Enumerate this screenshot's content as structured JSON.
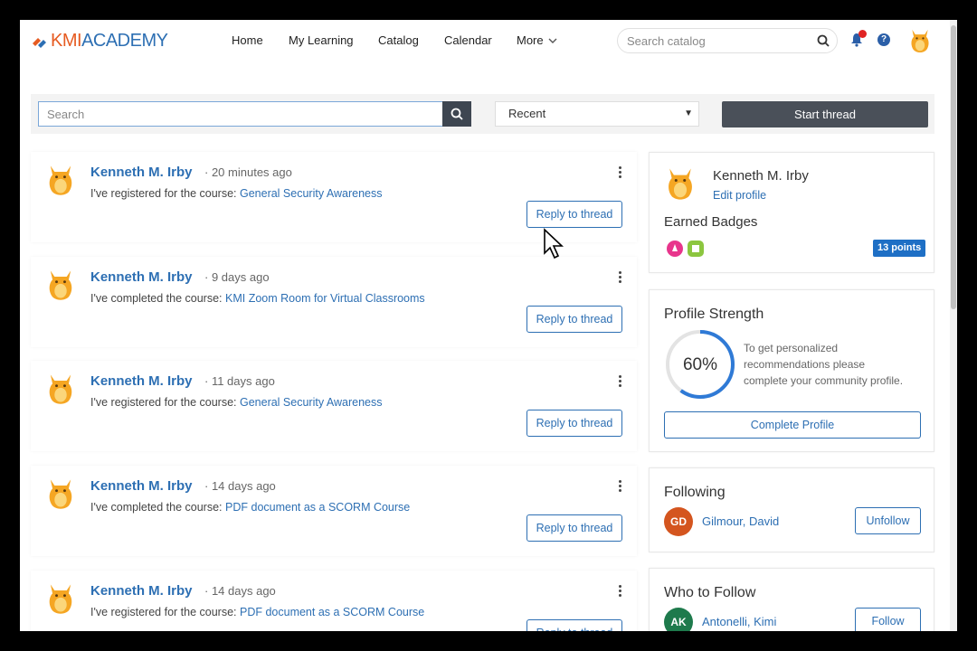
{
  "header": {
    "logo_prefix": "KMI",
    "logo_suffix": "ACADEMY",
    "nav": [
      "Home",
      "My Learning",
      "Catalog",
      "Calendar",
      "More"
    ],
    "search_placeholder": "Search catalog",
    "help_glyph": "?"
  },
  "toolbar": {
    "search_placeholder": "Search",
    "sort_value": "Recent",
    "start_thread_label": "Start thread"
  },
  "feed": [
    {
      "name": "Kenneth M. Irby",
      "time": "20 minutes ago",
      "action": "I've registered for the course:",
      "course": "General Security Awareness",
      "reply": "Reply to thread"
    },
    {
      "name": "Kenneth M. Irby",
      "time": "9 days ago",
      "action": "I've completed the course:",
      "course": "KMI Zoom Room for Virtual Classrooms",
      "reply": "Reply to thread"
    },
    {
      "name": "Kenneth M. Irby",
      "time": "11 days ago",
      "action": "I've registered for the course:",
      "course": "General Security Awareness",
      "reply": "Reply to thread"
    },
    {
      "name": "Kenneth M. Irby",
      "time": "14 days ago",
      "action": "I've completed the course:",
      "course": "PDF document as a SCORM Course",
      "reply": "Reply to thread"
    },
    {
      "name": "Kenneth M. Irby",
      "time": "14 days ago",
      "action": "I've registered for the course:",
      "course": "PDF document as a SCORM Course",
      "reply": "Reply to thread"
    }
  ],
  "profile": {
    "name": "Kenneth M. Irby",
    "edit_label": "Edit profile",
    "badges_title": "Earned Badges",
    "points": "13 points"
  },
  "strength": {
    "title": "Profile Strength",
    "percent_label": "60%",
    "percent": 0.6,
    "line1": "To get personalized",
    "line2": "recommendations please",
    "line3": "complete your community profile.",
    "button": "Complete Profile"
  },
  "following": {
    "title": "Following",
    "initials": "GD",
    "person": "Gilmour, David",
    "button": "Unfollow"
  },
  "who_to_follow": {
    "title": "Who to Follow",
    "initials": "AK",
    "person": "Antonelli, Kimi",
    "button": "Follow"
  },
  "colors": {
    "link": "#2d6fb3",
    "brand_orange": "#e65b21",
    "dark_button": "#4a5059",
    "notification": "#e02424",
    "gd_avatar": "#d4551f",
    "ak_avatar": "#1e7a4c"
  }
}
